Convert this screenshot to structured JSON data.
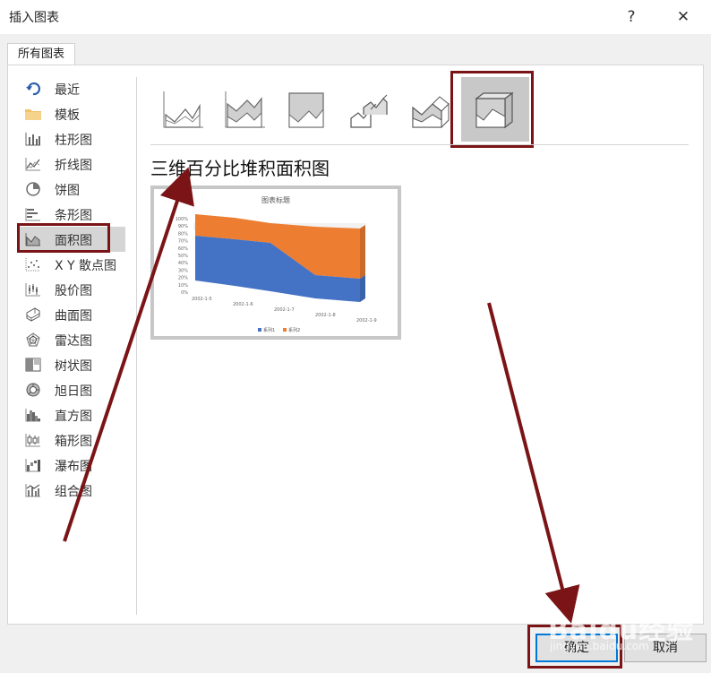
{
  "window": {
    "title": "插入图表",
    "help_label": "?",
    "close_label": "✕"
  },
  "tab": {
    "label": "所有图表"
  },
  "categories": [
    {
      "label": "最近",
      "icon": "recent-icon"
    },
    {
      "label": "模板",
      "icon": "folder-icon"
    },
    {
      "label": "柱形图",
      "icon": "column-chart-icon"
    },
    {
      "label": "折线图",
      "icon": "line-chart-icon"
    },
    {
      "label": "饼图",
      "icon": "pie-chart-icon"
    },
    {
      "label": "条形图",
      "icon": "bar-chart-icon"
    },
    {
      "label": "面积图",
      "icon": "area-chart-icon"
    },
    {
      "label": "X Y 散点图",
      "icon": "scatter-chart-icon"
    },
    {
      "label": "股价图",
      "icon": "stock-chart-icon"
    },
    {
      "label": "曲面图",
      "icon": "surface-chart-icon"
    },
    {
      "label": "雷达图",
      "icon": "radar-chart-icon"
    },
    {
      "label": "树状图",
      "icon": "treemap-chart-icon"
    },
    {
      "label": "旭日图",
      "icon": "sunburst-chart-icon"
    },
    {
      "label": "直方图",
      "icon": "histogram-chart-icon"
    },
    {
      "label": "箱形图",
      "icon": "box-whisker-chart-icon"
    },
    {
      "label": "瀑布图",
      "icon": "waterfall-chart-icon"
    },
    {
      "label": "组合图",
      "icon": "combo-chart-icon"
    }
  ],
  "selected_category": "面积图",
  "subtypes": [
    {
      "icon": "area-icon"
    },
    {
      "icon": "stacked-area-icon"
    },
    {
      "icon": "percent-stacked-area-icon"
    },
    {
      "icon": "3d-area-icon"
    },
    {
      "icon": "3d-stacked-area-icon"
    },
    {
      "icon": "3d-percent-stacked-area-icon"
    }
  ],
  "selected_subtype_name": "三维百分比堆积面积图",
  "preview": {
    "title": "图表标题",
    "y_ticks": [
      "100%",
      "90%",
      "80%",
      "70%",
      "60%",
      "50%",
      "40%",
      "30%",
      "20%",
      "10%",
      "0%"
    ],
    "x_ticks": [
      "2002-1-5",
      "2002-1-6",
      "2002-1-7",
      "2002-1-8",
      "2002-1-9"
    ],
    "legend": [
      {
        "name": "系列1",
        "color": "#4472c4"
      },
      {
        "name": "系列2",
        "color": "#ed7d31"
      }
    ]
  },
  "buttons": {
    "ok_label": "确定",
    "cancel_label": "取消"
  },
  "colors": {
    "highlight": "#7a1416",
    "series1": "#4472c4",
    "series2": "#ed7d31"
  },
  "watermark": {
    "brand": "Baidu经验",
    "url": "jingyan.baidu.com"
  }
}
